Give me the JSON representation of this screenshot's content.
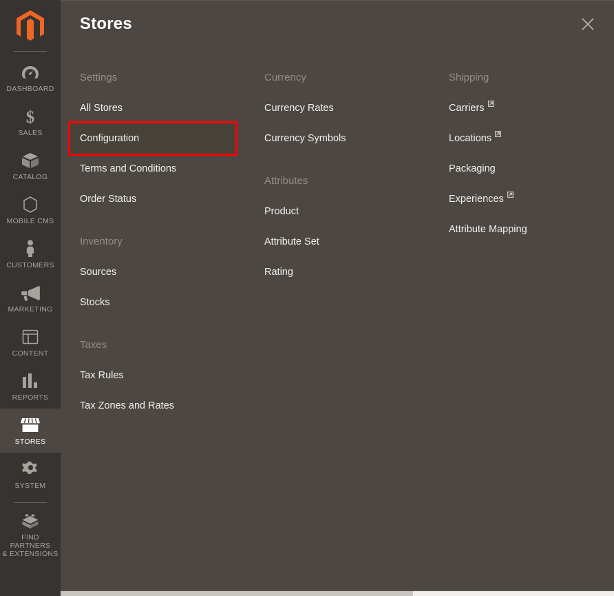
{
  "sidebar": {
    "logo": {
      "name": "magento-logo",
      "color": "#ec6723"
    },
    "items": [
      {
        "id": "dashboard",
        "label": "DASHBOARD",
        "icon": "dashboard-gauge-icon",
        "active": false
      },
      {
        "id": "sales",
        "label": "SALES",
        "icon": "dollar-sign-icon",
        "active": false
      },
      {
        "id": "catalog",
        "label": "CATALOG",
        "icon": "box-icon",
        "active": false
      },
      {
        "id": "mobile-cms",
        "label": "MOBILE CMS",
        "icon": "hexagon-icon",
        "active": false
      },
      {
        "id": "customers",
        "label": "CUSTOMERS",
        "icon": "person-icon",
        "active": false
      },
      {
        "id": "marketing",
        "label": "MARKETING",
        "icon": "megaphone-icon",
        "active": false
      },
      {
        "id": "content",
        "label": "CONTENT",
        "icon": "layout-icon",
        "active": false
      },
      {
        "id": "reports",
        "label": "REPORTS",
        "icon": "bar-chart-icon",
        "active": false
      },
      {
        "id": "stores",
        "label": "STORES",
        "icon": "storefront-icon",
        "active": true
      },
      {
        "id": "system",
        "label": "SYSTEM",
        "icon": "gear-icon",
        "active": false
      },
      {
        "id": "partners",
        "label": "FIND PARTNERS\n& EXTENSIONS",
        "icon": "lego-brick-icon",
        "active": false
      }
    ]
  },
  "panel": {
    "title": "Stores",
    "close_icon": "close-x-icon",
    "columns": [
      {
        "id": "column-1",
        "groups": [
          {
            "id": "settings",
            "title": "Settings",
            "links": [
              {
                "id": "all-stores",
                "label": "All Stores",
                "external": false,
                "highlighted": false
              },
              {
                "id": "configuration",
                "label": "Configuration",
                "external": false,
                "highlighted": true
              },
              {
                "id": "terms-and-conditions",
                "label": "Terms and Conditions",
                "external": false,
                "highlighted": false
              },
              {
                "id": "order-status",
                "label": "Order Status",
                "external": false,
                "highlighted": false
              }
            ]
          },
          {
            "id": "inventory",
            "title": "Inventory",
            "links": [
              {
                "id": "sources",
                "label": "Sources",
                "external": false,
                "highlighted": false
              },
              {
                "id": "stocks",
                "label": "Stocks",
                "external": false,
                "highlighted": false
              }
            ]
          },
          {
            "id": "taxes",
            "title": "Taxes",
            "links": [
              {
                "id": "tax-rules",
                "label": "Tax Rules",
                "external": false,
                "highlighted": false
              },
              {
                "id": "tax-zones-and-rates",
                "label": "Tax Zones and Rates",
                "external": false,
                "highlighted": false
              }
            ]
          }
        ]
      },
      {
        "id": "column-2",
        "groups": [
          {
            "id": "currency",
            "title": "Currency",
            "links": [
              {
                "id": "currency-rates",
                "label": "Currency Rates",
                "external": false,
                "highlighted": false
              },
              {
                "id": "currency-symbols",
                "label": "Currency Symbols",
                "external": false,
                "highlighted": false
              }
            ]
          },
          {
            "id": "attributes",
            "title": "Attributes",
            "links": [
              {
                "id": "product",
                "label": "Product",
                "external": false,
                "highlighted": false
              },
              {
                "id": "attribute-set",
                "label": "Attribute Set",
                "external": false,
                "highlighted": false
              },
              {
                "id": "rating",
                "label": "Rating",
                "external": false,
                "highlighted": false
              }
            ]
          }
        ]
      },
      {
        "id": "column-3",
        "groups": [
          {
            "id": "shipping",
            "title": "Shipping",
            "links": [
              {
                "id": "carriers",
                "label": "Carriers",
                "external": true,
                "highlighted": false
              },
              {
                "id": "locations",
                "label": "Locations",
                "external": true,
                "highlighted": false
              },
              {
                "id": "packaging",
                "label": "Packaging",
                "external": false,
                "highlighted": false
              },
              {
                "id": "experiences",
                "label": "Experiences",
                "external": true,
                "highlighted": false
              },
              {
                "id": "attribute-mapping",
                "label": "Attribute Mapping",
                "external": false,
                "highlighted": false
              }
            ]
          }
        ]
      }
    ]
  },
  "colors": {
    "sidebar_bg": "#373330",
    "panel_bg": "#4c4742",
    "accent_orange": "#ec6723",
    "highlight_red": "#ff0000",
    "label_muted": "#948d86",
    "link_text": "#f2f0ee"
  }
}
